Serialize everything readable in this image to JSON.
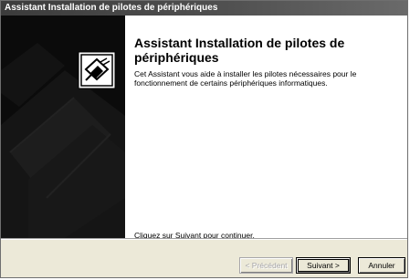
{
  "window": {
    "title": "Assistant Installation de pilotes de périphériques"
  },
  "wizard": {
    "heading": "Assistant Installation de pilotes de périphériques",
    "description": "Cet Assistant vous aide à installer les pilotes nécessaires pour le fonctionnement de certains périphériques informatiques.",
    "hint": "Cliquez sur Suivant pour continuer.",
    "icon": "hardware-install-icon"
  },
  "buttons": {
    "back_label": "< Précédent",
    "next_label": "Suivant >",
    "cancel_label": "Annuler"
  },
  "colors": {
    "side_panel": "#0b0b0b",
    "dialog_face": "#ece9d8",
    "title_bar": "#3c3c3c"
  }
}
